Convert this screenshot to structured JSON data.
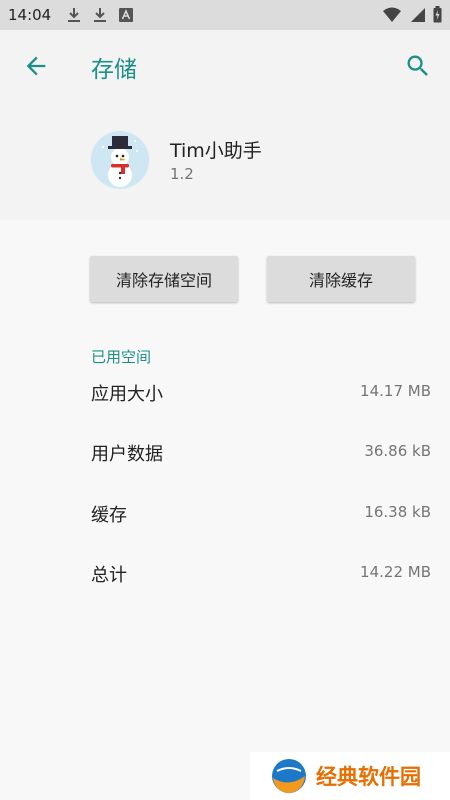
{
  "status_bar": {
    "time": "14:04",
    "notification_icons": [
      "download-icon",
      "download-icon",
      "a-icon"
    ],
    "system_icons": [
      "wifi-icon",
      "signal-icon",
      "battery-icon"
    ]
  },
  "header": {
    "title": "存储",
    "app": {
      "name": "Tim小助手",
      "version": "1.2"
    }
  },
  "actions": {
    "clear_storage_label": "清除存储空间",
    "clear_cache_label": "清除缓存"
  },
  "usage": {
    "section_title": "已用空间",
    "rows": [
      {
        "label": "应用大小",
        "value": "14.17 MB"
      },
      {
        "label": "用户数据",
        "value": "36.86 kB"
      },
      {
        "label": "缓存",
        "value": "16.38 kB"
      },
      {
        "label": "总计",
        "value": "14.22 MB"
      }
    ]
  },
  "watermark": {
    "text": "经典软件园"
  },
  "colors": {
    "accent": "#1b8f88",
    "header_bg": "#f3f3f3",
    "body_bg": "#f8f8f8",
    "button_bg": "#dcdcdc",
    "watermark": "#e76e00"
  }
}
